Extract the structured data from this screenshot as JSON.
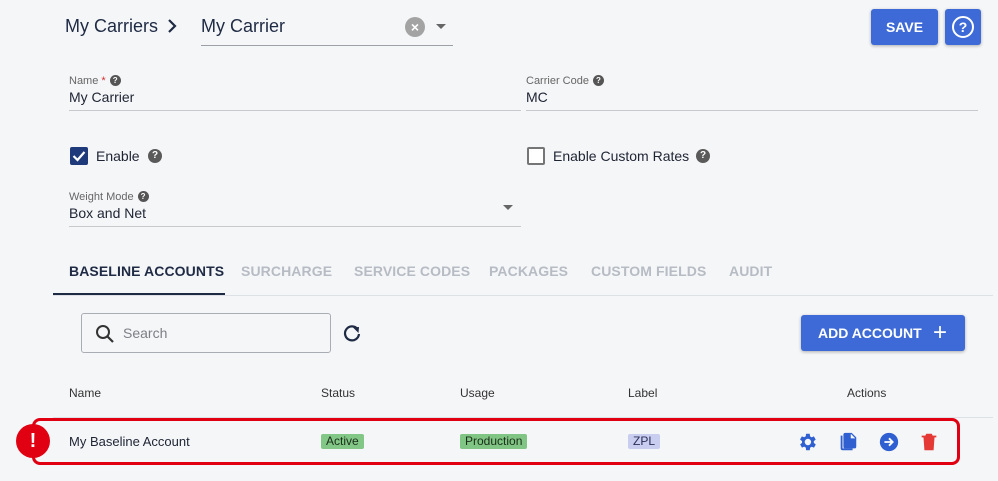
{
  "header": {
    "breadcrumb_root": "My Carriers",
    "carrier_select_value": "My Carrier",
    "save_label": "SAVE"
  },
  "form": {
    "name_label": "Name",
    "name_required": "*",
    "name_value": "My Carrier",
    "carrier_code_label": "Carrier Code",
    "carrier_code_value": "MC",
    "enable_label": "Enable",
    "enable_checked": true,
    "enable_custom_rates_label": "Enable Custom Rates",
    "enable_custom_rates_checked": false,
    "weight_mode_label": "Weight Mode",
    "weight_mode_value": "Box and Net"
  },
  "tabs": [
    {
      "label": "BASELINE ACCOUNTS",
      "active": true
    },
    {
      "label": "SURCHARGE",
      "active": false
    },
    {
      "label": "SERVICE CODES",
      "active": false
    },
    {
      "label": "PACKAGES",
      "active": false
    },
    {
      "label": "CUSTOM FIELDS",
      "active": false
    },
    {
      "label": "AUDIT",
      "active": false
    }
  ],
  "toolbar": {
    "search_placeholder": "Search",
    "add_account_label": "ADD ACCOUNT"
  },
  "table": {
    "columns": [
      "Name",
      "Status",
      "Usage",
      "Label",
      "Actions"
    ],
    "rows": [
      {
        "name": "My Baseline Account",
        "status": "Active",
        "usage": "Production",
        "label": "ZPL",
        "error": "!"
      }
    ]
  },
  "colors": {
    "primary": "#3d6ad6",
    "error": "#e00012",
    "delete": "#e53935",
    "nav": "#1f2a44"
  },
  "icons": [
    "chevron-right-icon",
    "clear-icon",
    "dropdown-caret-icon",
    "help-icon",
    "checkmark-icon",
    "search-icon",
    "refresh-icon",
    "plus-icon",
    "gear-icon",
    "copy-icon",
    "arrow-right-circle-icon",
    "trash-icon"
  ]
}
